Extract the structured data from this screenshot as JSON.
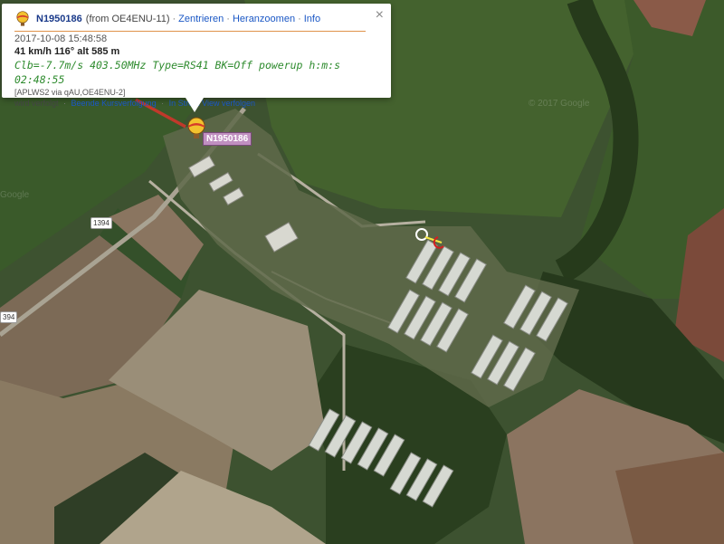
{
  "popup": {
    "callsign": "N1950186",
    "from_text": "(from OE4ENU-11)",
    "links": [
      "Zentrieren",
      "Heranzoomen",
      "Info"
    ],
    "separator": "·",
    "close_label": "×",
    "timestamp": "2017-10-08 15:48:58",
    "speed_line": "41 km/h 116° alt 585 m",
    "comment": "Clb=-7.7m/s 403.50MHz Type=RS41 BK=Off powerup h:m:s 02:48:55",
    "via_line": "[APLWS2 via qAU,OE4ENU-2]",
    "follow_text": "wird verfolgt",
    "follow_links": [
      "Beende Kursverfolgung",
      "In Street View verfolgen"
    ]
  },
  "marker": {
    "label": "N1950186",
    "icon": "balloon-icon",
    "color_label_bg": "#c08fc0"
  },
  "map": {
    "road_labels": [
      "1394",
      "394"
    ],
    "watermark": "© 2017 Google",
    "watermark_left": "Google",
    "colors": {
      "field_green": "#3f5a2c",
      "forest": "#27391d",
      "plowed": "#7a6a58",
      "light_field": "#9a8e7c",
      "track_red": "#c0392b",
      "track_yellow": "#f5e642"
    }
  }
}
